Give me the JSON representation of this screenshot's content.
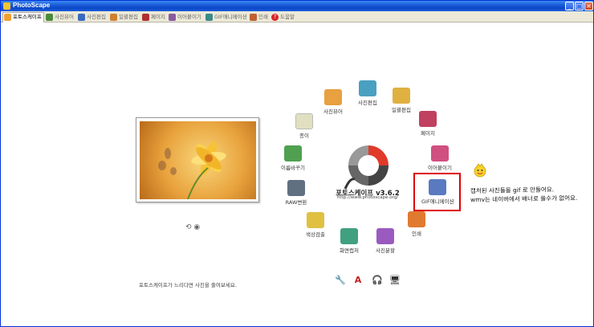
{
  "window": {
    "title": "PhotoScape"
  },
  "window_buttons": {
    "minimize": "_",
    "maximize": "□",
    "close": "×"
  },
  "tabs": [
    {
      "label": "포토스케이프",
      "color": "#f0a030"
    },
    {
      "label": "사진뷰어",
      "color": "#4a8a3a"
    },
    {
      "label": "사진편집",
      "color": "#3a6ac0"
    },
    {
      "label": "일괄편집",
      "color": "#d08030"
    },
    {
      "label": "페이지",
      "color": "#b03030"
    },
    {
      "label": "이어붙이기",
      "color": "#8a5aa0"
    },
    {
      "label": "GIF애니메이션",
      "color": "#3a8a8a"
    },
    {
      "label": "인쇄",
      "color": "#c06030"
    },
    {
      "label": "도움말",
      "color": "#d22222"
    }
  ],
  "menu": [
    {
      "label": "사진뷰어",
      "color": "#e8a040"
    },
    {
      "label": "사진편집",
      "color": "#4aa0c0"
    },
    {
      "label": "일괄편집",
      "color": "#e0b040"
    },
    {
      "label": "페이지",
      "color": "#c04060"
    },
    {
      "label": "이어붙이기",
      "color": "#d05080"
    },
    {
      "label": "GIF애니메이션",
      "color": "#5a7ac0"
    },
    {
      "label": "인쇄",
      "color": "#e07a30"
    },
    {
      "label": "사진분할",
      "color": "#9a5ac0"
    },
    {
      "label": "화면캡처",
      "color": "#40a080"
    },
    {
      "label": "색상검출",
      "color": "#e0c040"
    },
    {
      "label": "RAW변환",
      "color": "#607080"
    },
    {
      "label": "이름바꾸기",
      "color": "#50a050"
    },
    {
      "label": "종이",
      "color": "#e0e0c0"
    }
  ],
  "logo": {
    "title": "포토스케이프 v3.6.2",
    "url": "http://www.photoscape.org/"
  },
  "annotation": {
    "line1": "캡처된 사진들을 gif 로 만들어요.",
    "line2": "wmv는 네이버에서 배너로 쓸수가 없어요."
  },
  "bottom_hint": "포토스케이프가 느리다면 사진을 줄여보세요.",
  "tools": {
    "wrench": "🔧",
    "font": "A",
    "headset": "🎧",
    "computer": "🖥"
  }
}
